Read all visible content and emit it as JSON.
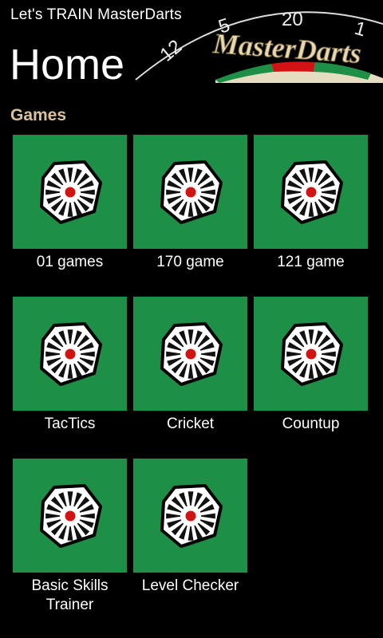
{
  "app": {
    "title": "Let's TRAIN MasterDarts"
  },
  "header": {
    "page_title": "Home",
    "logo_text": "MasterDarts",
    "board_numbers": [
      "12",
      "5",
      "20",
      "1"
    ]
  },
  "games_section": {
    "title": "Games",
    "tile_icon": "dartboard-segment-icon",
    "items": [
      {
        "label": "01 games"
      },
      {
        "label": "170 game"
      },
      {
        "label": "121 game"
      },
      {
        "label": "TacTics"
      },
      {
        "label": "Cricket"
      },
      {
        "label": "Countup"
      },
      {
        "label": "Basic Skills\nTrainer"
      },
      {
        "label": "Level Checker"
      }
    ]
  },
  "colors": {
    "background": "#000000",
    "tile_green": "#1e8f47",
    "section_title": "#d9c39a",
    "board_red": "#d01414",
    "logo_cream": "#e8d8b0"
  }
}
